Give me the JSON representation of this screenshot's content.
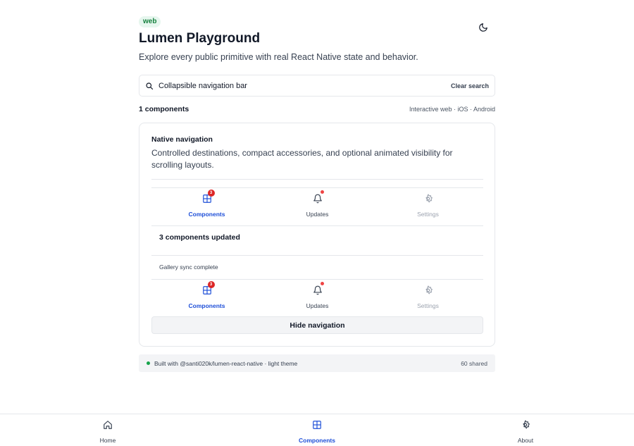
{
  "header": {
    "platform_badge": "web",
    "title": "Lumen Playground",
    "subtitle": "Explore every public primitive with real React Native state and behavior."
  },
  "theme_toggle": {
    "icon": "moon-icon"
  },
  "search": {
    "value": "Collapsible navigation bar",
    "clear_label": "Clear search",
    "icon": "search-icon"
  },
  "results": {
    "count_label": "1 components",
    "platforms_label": "Interactive web · iOS · Android"
  },
  "card": {
    "title": "Native navigation",
    "description": "Controlled destinations, compact accessories, and optional animated visibility for scrolling layouts.",
    "navbar": {
      "items": [
        {
          "label": "Components",
          "icon": "grid-icon",
          "badge": "3",
          "state": "active"
        },
        {
          "label": "Updates",
          "icon": "bell-icon",
          "dot": true,
          "state": "normal"
        },
        {
          "label": "Settings",
          "icon": "gear-icon",
          "state": "disabled"
        }
      ]
    },
    "updated_title": "3 components updated",
    "status_text": "Gallery sync complete",
    "hide_button_label": "Hide navigation"
  },
  "footer": {
    "built_with": "Built with @santi020k/lumen-react-native · light theme",
    "shared": "60 shared",
    "status_color": "#16a34a"
  },
  "tabbar": {
    "tabs": [
      {
        "label": "Home",
        "icon": "home-icon",
        "active": false
      },
      {
        "label": "Components",
        "icon": "grid-icon",
        "active": true
      },
      {
        "label": "About",
        "icon": "gear-icon",
        "active": false
      }
    ]
  },
  "colors": {
    "accent": "#1d4ed8",
    "badge": "#dc2626",
    "platform_badge_bg": "#e6f6ee"
  }
}
